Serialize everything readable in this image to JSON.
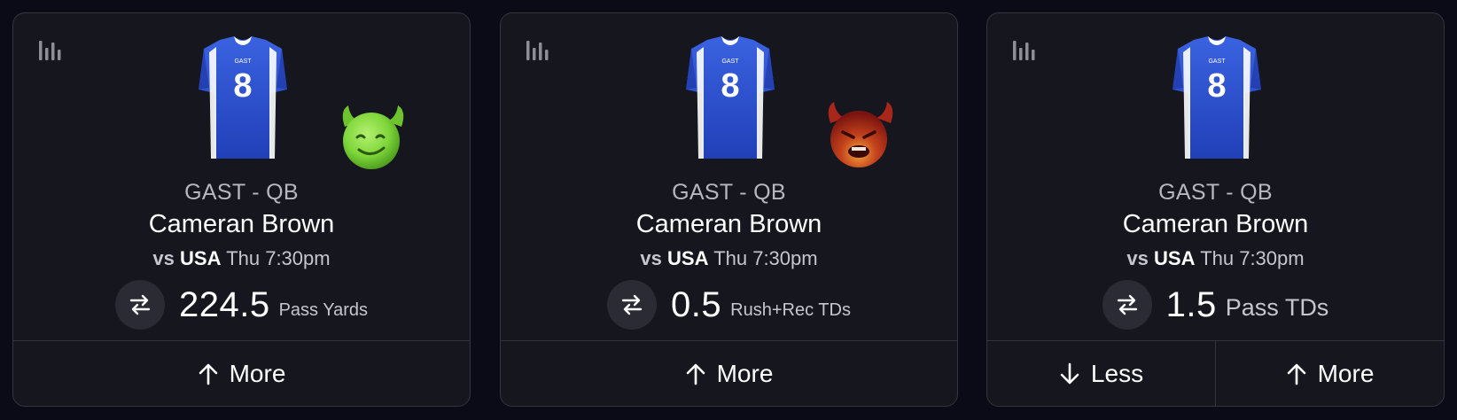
{
  "cards": [
    {
      "team_position": "GAST - QB",
      "player_name": "Cameran Brown",
      "vs_label": "vs",
      "opponent": "USA",
      "game_time": "Thu 7:30pm",
      "line_value": "224.5",
      "stat_type": "Pass Yards",
      "emoji": "green-devil",
      "buttons": [
        {
          "label": "More",
          "icon": "arrow-up-icon"
        }
      ]
    },
    {
      "team_position": "GAST - QB",
      "player_name": "Cameran Brown",
      "vs_label": "vs",
      "opponent": "USA",
      "game_time": "Thu 7:30pm",
      "line_value": "0.5",
      "stat_type": "Rush+Rec TDs",
      "emoji": "red-devil",
      "buttons": [
        {
          "label": "More",
          "icon": "arrow-up-icon"
        }
      ]
    },
    {
      "team_position": "GAST - QB",
      "player_name": "Cameran Brown",
      "vs_label": "vs",
      "opponent": "USA",
      "game_time": "Thu 7:30pm",
      "line_value": "1.5",
      "stat_type": "Pass TDs",
      "emoji": "",
      "buttons": [
        {
          "label": "Less",
          "icon": "arrow-down-icon"
        },
        {
          "label": "More",
          "icon": "arrow-up-icon"
        }
      ]
    }
  ],
  "jersey": {
    "number": "8",
    "team_text": "GAST",
    "color": "#2a52d4"
  },
  "colors": {
    "background": "#0b0b17",
    "card": "#16161f",
    "border": "#34343f",
    "green_devil": "#7fd63a",
    "red_devil": "#b8291d"
  }
}
